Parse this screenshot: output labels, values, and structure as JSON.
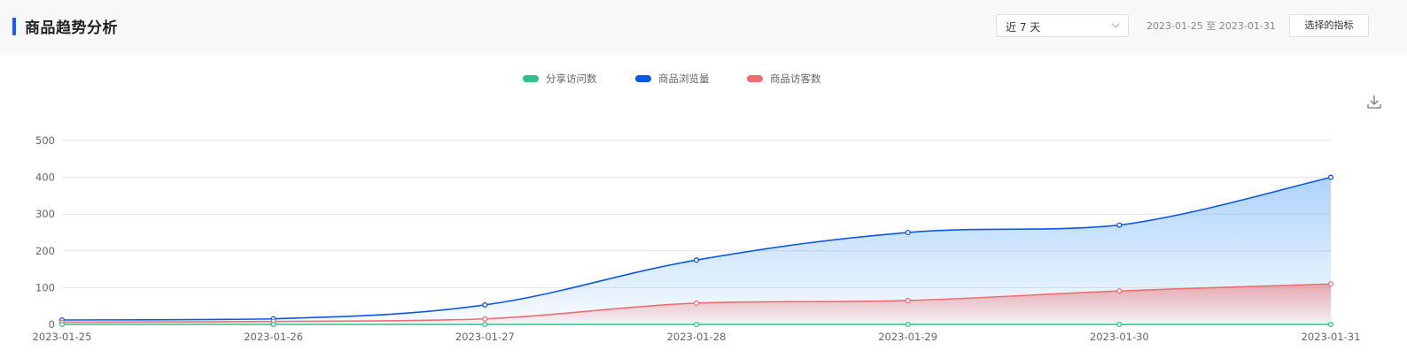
{
  "header": {
    "title": "商品趋势分析",
    "period_select": "近 7 天",
    "date_range": "2023-01-25 至 2023-01-31",
    "metrics_button": "选择的指标"
  },
  "colors": {
    "accent": "#1a5ff0",
    "share_visits": "#2ec28a",
    "product_views": "#0a57e8",
    "product_visitors": "#ee6e70"
  },
  "icons": {
    "select_arrow": "chevron-down-icon",
    "download": "download-icon"
  },
  "chart_data": {
    "type": "line",
    "categories": [
      "2023-01-25",
      "2023-01-26",
      "2023-01-27",
      "2023-01-28",
      "2023-01-29",
      "2023-01-30",
      "2023-01-31"
    ],
    "ylim": [
      0,
      500
    ],
    "yticks": [
      0,
      100,
      200,
      300,
      400,
      500
    ],
    "grid": true,
    "legend_position": "top-center",
    "series": [
      {
        "name": "分享访问数",
        "color": "#2ec28a",
        "values": [
          0,
          0,
          0,
          0,
          0,
          0,
          0
        ],
        "area": false
      },
      {
        "name": "商品浏览量",
        "color": "#0a57e8",
        "values": [
          12,
          15,
          53,
          175,
          250,
          270,
          400
        ],
        "area": true
      },
      {
        "name": "商品访客数",
        "color": "#ee6e70",
        "values": [
          6,
          8,
          15,
          58,
          65,
          91,
          110
        ],
        "area": true
      }
    ]
  }
}
